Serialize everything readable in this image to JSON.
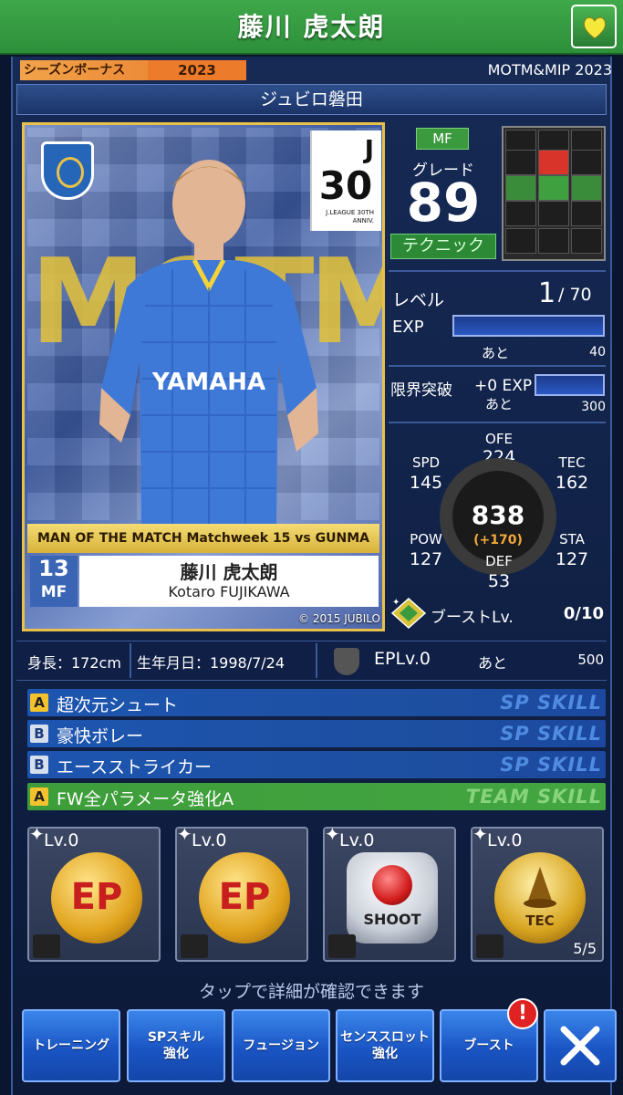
{
  "header": {
    "title": "藤川 虎太朗",
    "favorite_icon": "heart-icon"
  },
  "banner": {
    "season_label": "シーズンボーナス",
    "season_year": "2023",
    "card_type": "MOTM&MIP 2023"
  },
  "team": {
    "name": "ジュビロ磐田"
  },
  "card": {
    "bg_text": "MOTM",
    "jleague_letter": "J",
    "jleague_num": "30",
    "jleague_sub": "J.LEAGUE 30TH ANNIV.",
    "motm_strip": "MAN OF THE MATCH  Matchweek 15 vs GUNMA",
    "number": "13",
    "position": "MF",
    "name_jp": "藤川 虎太朗",
    "name_en": "Kotaro FUJIKAWA",
    "copyright": "© 2015 JUBILO"
  },
  "player": {
    "position": "MF",
    "grade_label": "グレード",
    "grade": "89",
    "style": "テクニック"
  },
  "level": {
    "label": "レベル",
    "value": "1",
    "max": "/ 70",
    "exp_label": "EXP",
    "exp_ato": "あと",
    "exp_remaining": "40",
    "exp_progress": 0.0
  },
  "limit": {
    "label": "限界突破",
    "value": "+0 EXP",
    "ato": "あと",
    "remaining": "300",
    "progress": 0.0
  },
  "stats": {
    "ofe_label": "OFE",
    "ofe": "224",
    "spd_label": "SPD",
    "spd": "145",
    "tec_label": "TEC",
    "tec": "162",
    "pow_label": "POW",
    "pow": "127",
    "sta_label": "STA",
    "sta": "127",
    "def_label": "DEF",
    "def": "53",
    "overall": "838",
    "overall_plus": "(+170)"
  },
  "boost": {
    "label": "ブーストLv.",
    "value": "0/10"
  },
  "info": {
    "height": "身長：172cm",
    "birth": "生年月日：1998/7/24",
    "ep_level": "EPLv.0",
    "ep_ato": "あと",
    "ep_remaining": "500"
  },
  "skills": [
    {
      "badge": "A",
      "name": "超次元シュート",
      "type": "SP SKILL"
    },
    {
      "badge": "B",
      "name": "豪快ボレー",
      "type": "SP SKILL"
    },
    {
      "badge": "B",
      "name": "エースストライカー",
      "type": "SP SKILL"
    },
    {
      "badge": "A",
      "name": "FW全パラメータ強化A",
      "type": "TEAM SKILL"
    }
  ],
  "slots": [
    {
      "level": "Lv.0",
      "medal": "EP",
      "icon": "ep-medal-icon"
    },
    {
      "level": "Lv.0",
      "medal": "EP",
      "icon": "ep-medal-icon"
    },
    {
      "level": "Lv.0",
      "medal": "SHOOT",
      "icon": "shoot-medal-icon"
    },
    {
      "level": "Lv.0",
      "medal": "TEC",
      "icon": "tec-medal-icon",
      "count": "5/5"
    }
  ],
  "hint": "タップで詳細が確認できます",
  "buttons": {
    "training": "トレーニング",
    "sp_skill_1": "SPスキル",
    "sp_skill_2": "強化",
    "fusion": "フュージョン",
    "sense_1": "センススロット",
    "sense_2": "強化",
    "boost": "ブースト",
    "alert": "!"
  },
  "colors": {
    "header_green": "#3fa84a",
    "sp_skill": "#1d55b0",
    "team_skill": "#43a641",
    "gold": "#e8c04a",
    "button_blue": "#1a55c4"
  }
}
